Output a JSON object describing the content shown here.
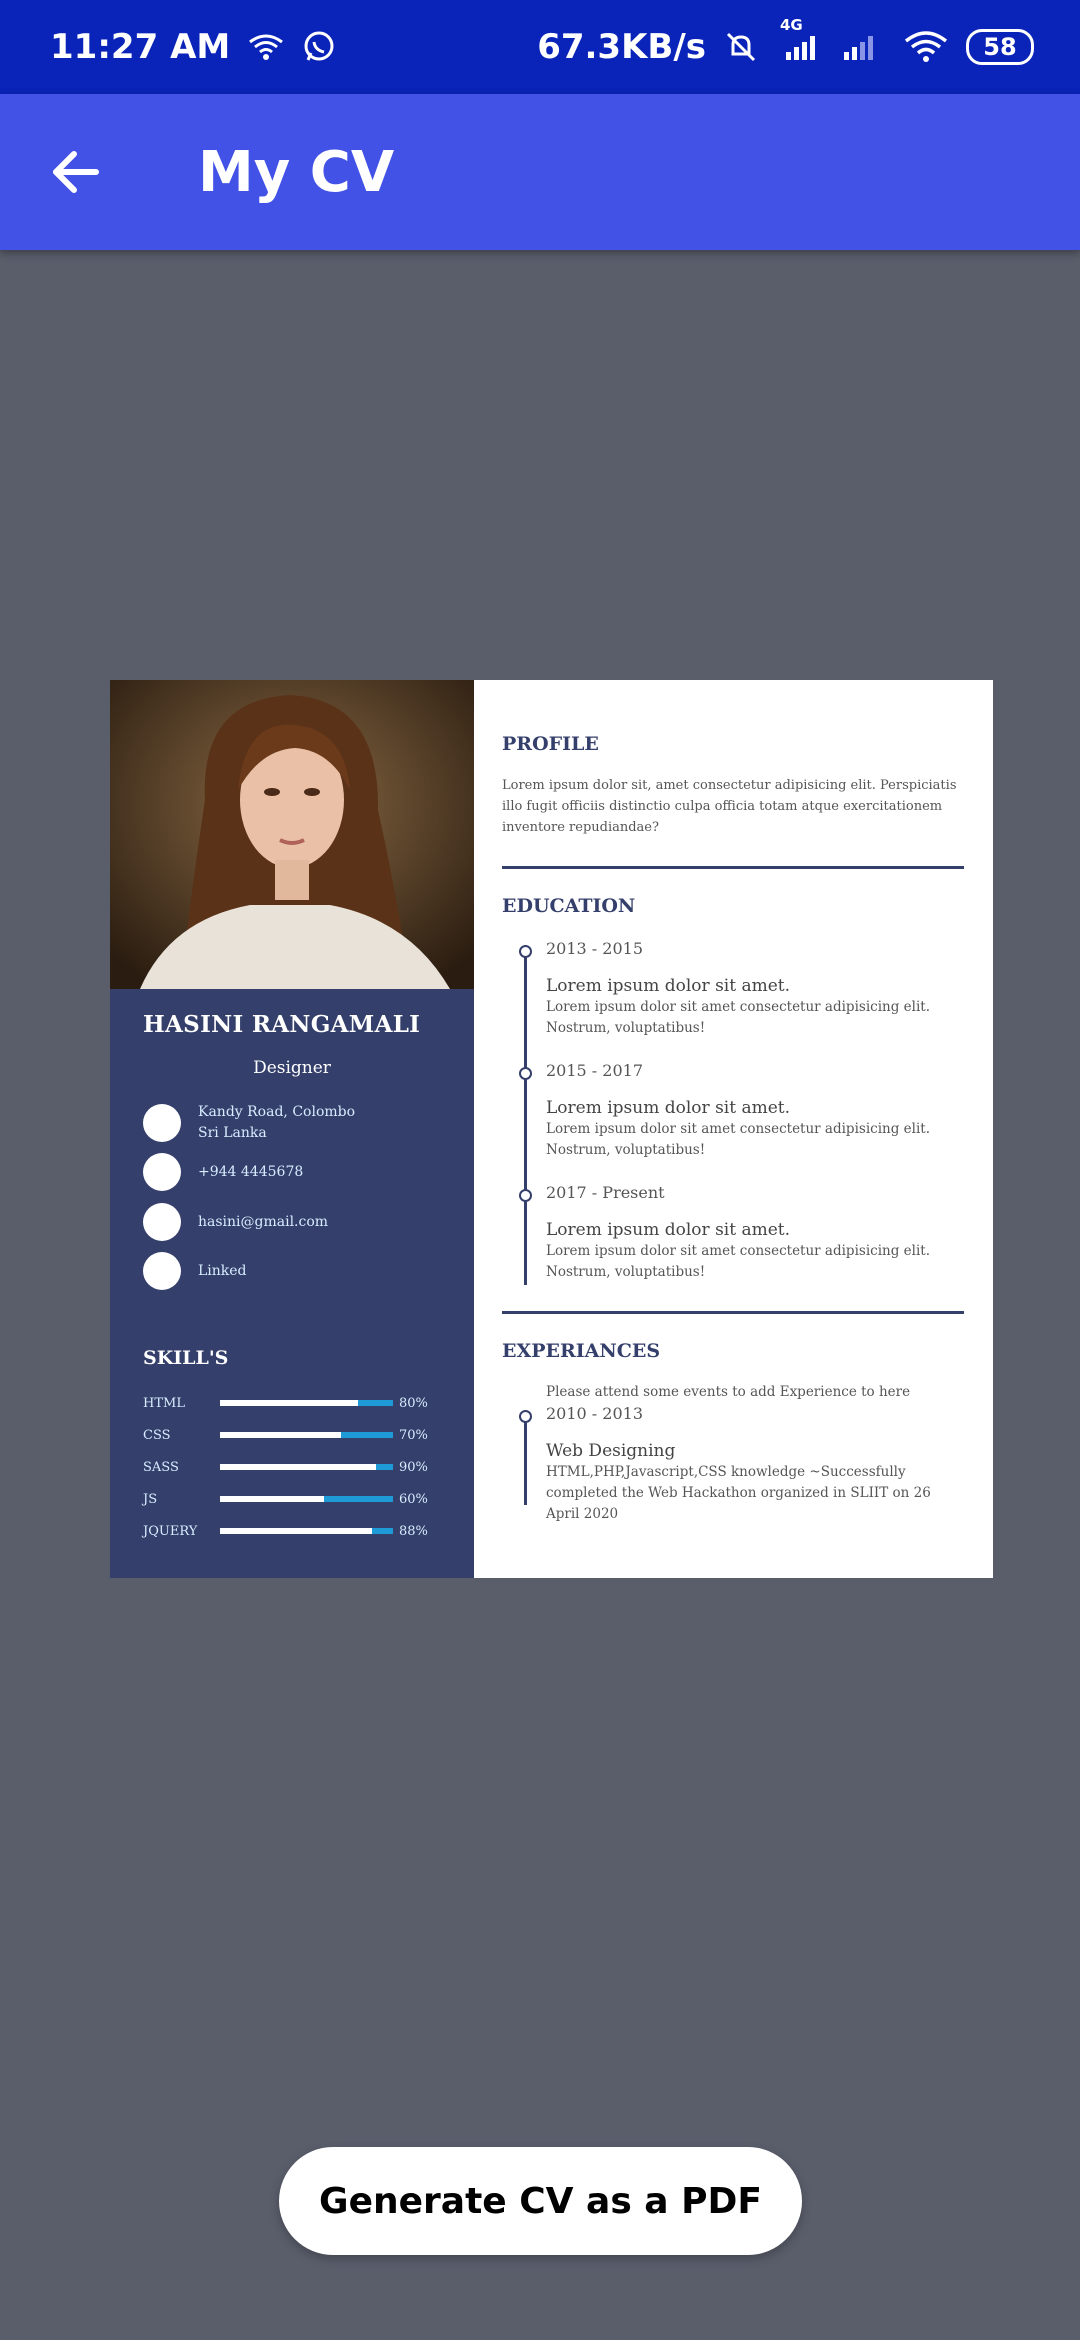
{
  "status_bar": {
    "time": "11:27 AM",
    "speed": "67.3KB/s",
    "network": "4G",
    "battery": "58",
    "icons": [
      "wifi-calling-icon",
      "whatsapp-icon",
      "muted-bell-icon",
      "signal-icon",
      "wifi-icon"
    ]
  },
  "app_bar": {
    "title": "My CV",
    "back_icon": "arrow-left-icon"
  },
  "cv": {
    "name": "HASINI RANGAMALI",
    "role": "Designer",
    "contacts": {
      "address_line1": "Kandy Road, Colombo",
      "address_line2": "Sri Lanka",
      "phone": "+944 4445678",
      "email": "hasini@gmail.com",
      "linked": "Linked"
    },
    "skills_title": "SKILL'S",
    "skills": [
      {
        "name": "HTML",
        "label": "80%",
        "level": 0.8
      },
      {
        "name": "CSS",
        "label": "70%",
        "level": 0.7
      },
      {
        "name": "SASS",
        "label": "90%",
        "level": 0.9
      },
      {
        "name": "JS",
        "label": "60%",
        "level": 0.6
      },
      {
        "name": "JQUERY",
        "label": "88%",
        "level": 0.88
      }
    ],
    "profile": {
      "title": "PROFILE",
      "text": "Lorem ipsum dolor sit, amet consectetur adipisicing elit. Perspiciatis illo fugit officiis distinctio culpa officia totam atque exercitationem inventore repudiandae?"
    },
    "education": {
      "title": "EDUCATION",
      "items": [
        {
          "date": "2013 - 2015",
          "heading": "Lorem ipsum dolor sit amet.",
          "desc": "Lorem ipsum dolor sit amet consectetur adipisicing elit. Nostrum, voluptatibus!"
        },
        {
          "date": "2015 - 2017",
          "heading": "Lorem ipsum dolor sit amet.",
          "desc": "Lorem ipsum dolor sit amet consectetur adipisicing elit. Nostrum, voluptatibus!"
        },
        {
          "date": "2017 - Present",
          "heading": "Lorem ipsum dolor sit amet.",
          "desc": "Lorem ipsum dolor sit amet consectetur adipisicing elit. Nostrum, voluptatibus!"
        }
      ]
    },
    "experiences": {
      "title": "EXPERIANCES",
      "note": "Please attend some events to add Experience to here",
      "items": [
        {
          "date": "2010 - 2013",
          "heading": "Web Designing",
          "desc": "HTML,PHP,Javascript,CSS knowledge ~Successfully completed the Web Hackathon organized in SLIIT on 26 April 2020"
        }
      ]
    }
  },
  "actions": {
    "generate_pdf": "Generate CV as a PDF"
  },
  "colors": {
    "status_bar": "#0a23b8",
    "app_bar": "#4352e6",
    "background": "#5a5e6b",
    "cv_sidebar": "#343f6b",
    "skill_track": "#1e9ad6"
  }
}
